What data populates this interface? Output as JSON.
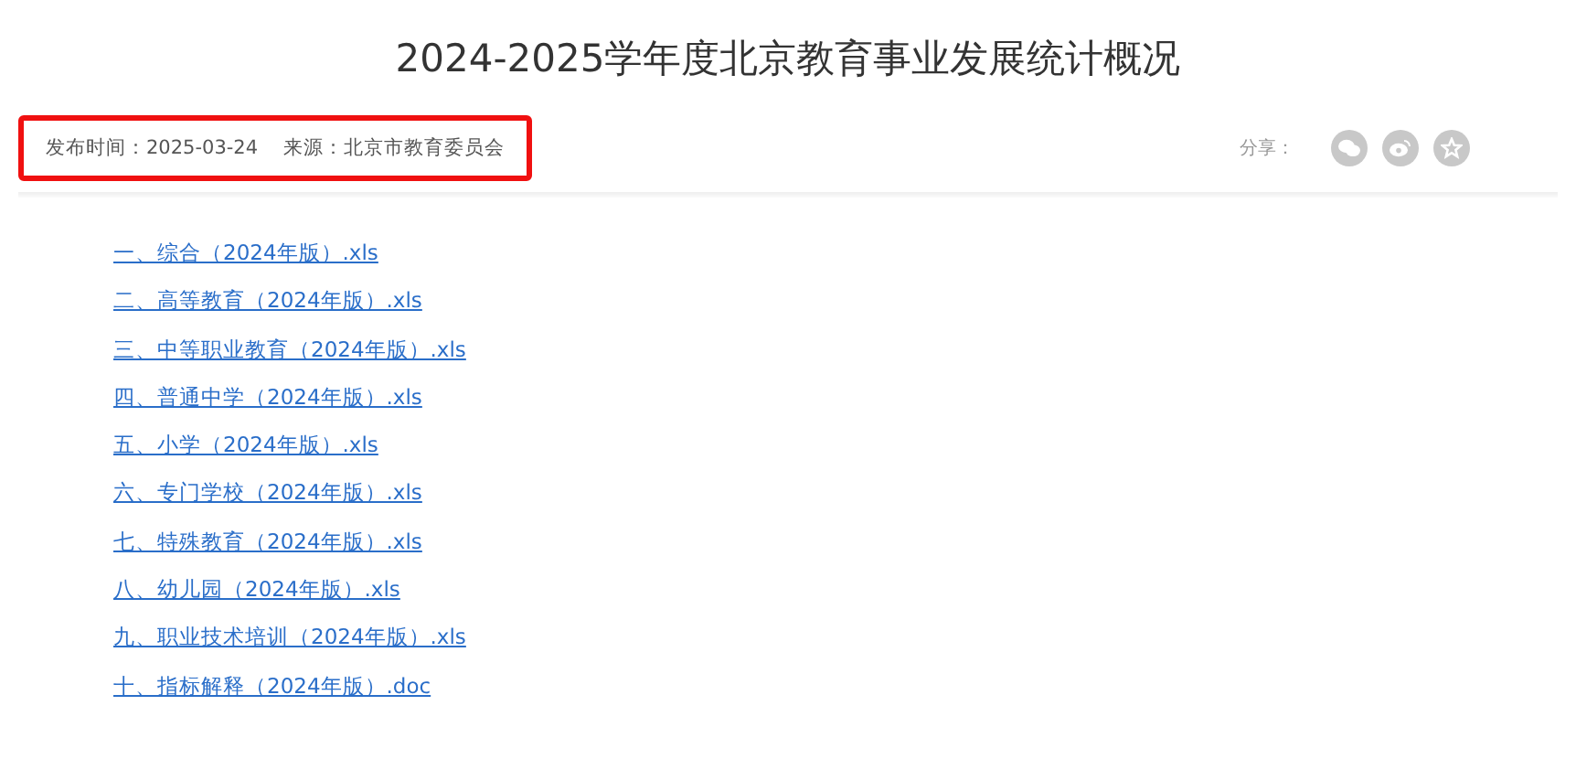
{
  "title": "2024-2025学年度北京教育事业发展统计概况",
  "meta": {
    "highlighted": true,
    "published": "发布时间：2025-03-24",
    "source": "来源：北京市教育委员会"
  },
  "share": {
    "label": "分享：",
    "buttons": [
      {
        "kind": "wechat"
      },
      {
        "kind": "weibo"
      },
      {
        "kind": "favorite"
      }
    ]
  },
  "files": [
    {
      "label": "一、综合（2024年版）.xls"
    },
    {
      "label": "二、高等教育（2024年版）.xls"
    },
    {
      "label": "三、中等职业教育（2024年版）.xls"
    },
    {
      "label": "四、普通中学（2024年版）.xls"
    },
    {
      "label": "五、小学（2024年版）.xls"
    },
    {
      "label": "六、专门学校（2024年版）.xls"
    },
    {
      "label": "七、特殊教育（2024年版）.xls"
    },
    {
      "label": "八、幼儿园（2024年版）.xls"
    },
    {
      "label": "九、职业技术培训（2024年版）.xls"
    },
    {
      "label": "十、指标解释（2024年版）.doc"
    }
  ]
}
